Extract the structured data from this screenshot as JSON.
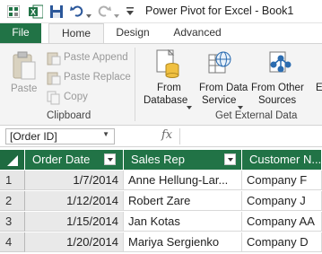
{
  "window": {
    "title": "Power Pivot for Excel - Book1"
  },
  "tabs": {
    "file": "File",
    "home": "Home",
    "design": "Design",
    "advanced": "Advanced"
  },
  "clipboard": {
    "paste": "Paste",
    "paste_append": "Paste Append",
    "paste_replace": "Paste Replace",
    "copy": "Copy",
    "group_label": "Clipboard"
  },
  "external_data": {
    "from_database_line1": "From",
    "from_database_line2": "Database",
    "from_data_service_line1": "From Data",
    "from_data_service_line2": "Service",
    "from_other_sources_line1": "From Other",
    "from_other_sources_line2": "Sources",
    "cut_off_label": "E",
    "group_label": "Get External Data"
  },
  "formula_bar": {
    "name_box": "[Order ID]",
    "fx": "fx"
  },
  "table": {
    "columns": [
      "Order Date",
      "Sales Rep",
      "Customer N..."
    ],
    "rows": [
      {
        "num": "1",
        "date": "1/7/2014",
        "rep": "Anne Hellung-Lar...",
        "customer": "Company F"
      },
      {
        "num": "2",
        "date": "1/12/2014",
        "rep": "Robert Zare",
        "customer": "Company J"
      },
      {
        "num": "3",
        "date": "1/15/2014",
        "rep": "Jan Kotas",
        "customer": "Company AA"
      },
      {
        "num": "4",
        "date": "1/20/2014",
        "rep": "Mariya Sergienko",
        "customer": "Company D"
      }
    ]
  },
  "colors": {
    "accent": "#217346",
    "ribbon_bg": "#f4f4f4",
    "disabled_text": "#999999"
  },
  "icons": [
    "excel-icon",
    "powerpivot-icon",
    "save-icon",
    "undo-icon",
    "redo-icon",
    "customize-icon",
    "paste-icon",
    "paste-append-icon",
    "paste-replace-icon",
    "copy-icon",
    "database-icon",
    "data-service-icon",
    "other-sources-icon",
    "fx-icon",
    "filter-icon"
  ]
}
